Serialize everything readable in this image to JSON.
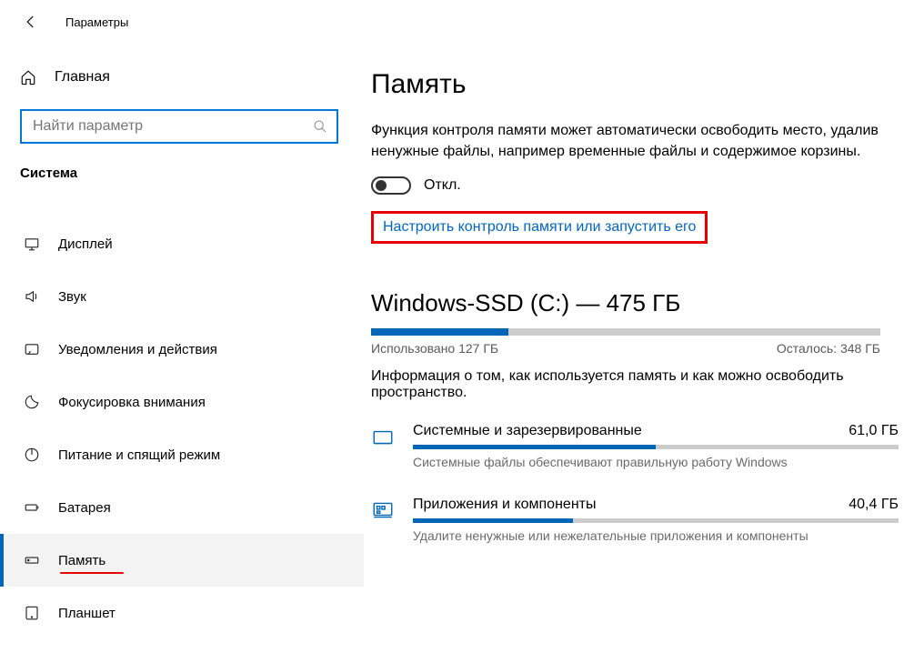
{
  "header": {
    "title": "Параметры"
  },
  "sidebar": {
    "home_label": "Главная",
    "search_placeholder": "Найти параметр",
    "group_label": "Система",
    "items": [
      {
        "label": "Дисплей",
        "key": "display"
      },
      {
        "label": "Звук",
        "key": "sound"
      },
      {
        "label": "Уведомления и действия",
        "key": "notifications"
      },
      {
        "label": "Фокусировка внимания",
        "key": "focus"
      },
      {
        "label": "Питание и спящий режим",
        "key": "power"
      },
      {
        "label": "Батарея",
        "key": "battery"
      },
      {
        "label": "Память",
        "key": "storage",
        "active": true
      },
      {
        "label": "Планшет",
        "key": "tablet"
      }
    ]
  },
  "main": {
    "title": "Память",
    "storage_sense_desc": "Функция контроля памяти может автоматически освободить место, удалив ненужные файлы, например временные файлы и содержимое корзины.",
    "toggle_state": "Откл.",
    "configure_link": "Настроить контроль памяти или запустить его",
    "drive": {
      "title": "Windows-SSD (C:) — 475 ГБ",
      "used_label": "Использовано 127 ГБ",
      "free_label": "Осталось: 348 ГБ",
      "fill_pct": 27,
      "info": "Информация о том, как используется память и как можно освободить пространство."
    },
    "categories": [
      {
        "name": "Системные и зарезервированные",
        "size": "61,0 ГБ",
        "sub": "Системные файлы обеспечивают правильную работу Windows",
        "pct": 50,
        "icon": "system"
      },
      {
        "name": "Приложения и компоненты",
        "size": "40,4 ГБ",
        "sub": "Удалите ненужные или нежелательные приложения и компоненты",
        "pct": 33,
        "icon": "apps"
      }
    ]
  }
}
